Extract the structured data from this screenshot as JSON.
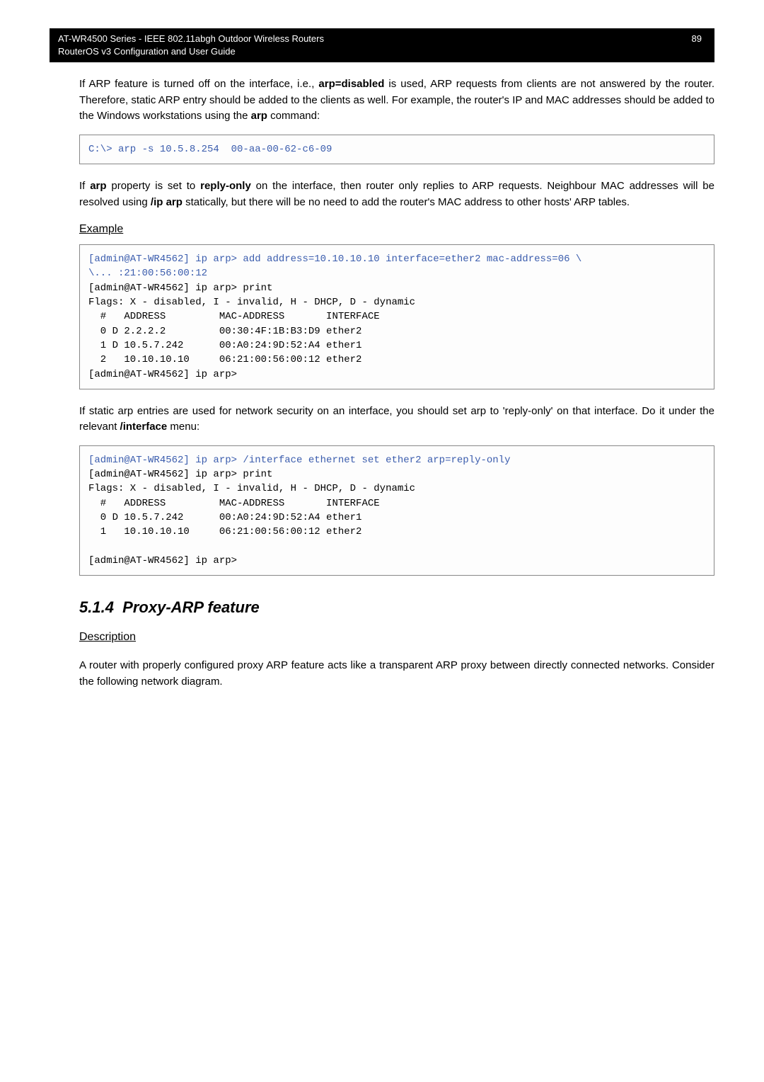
{
  "header": {
    "title_line1": "AT-WR4500 Series - IEEE 802.11abgh Outdoor Wireless Routers",
    "title_line2": "RouterOS v3 Configuration and User Guide",
    "page_number": "89"
  },
  "para1_pre": "If ARP feature is turned off on the interface, i.e., ",
  "para1_bold1": "arp=disabled",
  "para1_mid": " is used, ARP requests from clients are not answered by the router. Therefore, static ARP entry should be added to the clients as well. For example, the router's IP and MAC addresses should be added to the Windows workstations using the ",
  "para1_bold2": "arp",
  "para1_post": " command:",
  "code1": "C:\\> arp -s 10.5.8.254  00-aa-00-62-c6-09",
  "para2_pre": "If ",
  "para2_bold1": "arp",
  "para2_mid1": " property is set to ",
  "para2_bold2": "reply-only",
  "para2_mid2": " on the interface, then router only replies to ARP requests. Neighbour MAC addresses will be resolved using ",
  "para2_bold3": "/ip arp",
  "para2_post": " statically, but there will be no need to add the router's MAC address to other hosts' ARP tables.",
  "example_heading": "Example",
  "code2_blue": "[admin@AT-WR4562] ip arp> add address=10.10.10.10 interface=ether2 mac-address=06 \\\n\\... :21:00:56:00:12",
  "code2_rest": "[admin@AT-WR4562] ip arp> print\nFlags: X - disabled, I - invalid, H - DHCP, D - dynamic\n  #   ADDRESS         MAC-ADDRESS       INTERFACE\n  0 D 2.2.2.2         00:30:4F:1B:B3:D9 ether2\n  1 D 10.5.7.242      00:A0:24:9D:52:A4 ether1\n  2   10.10.10.10     06:21:00:56:00:12 ether2\n[admin@AT-WR4562] ip arp>",
  "para3_pre": "If static arp entries are used for network security on an interface, you should set arp to 'reply-only' on that interface. Do it under the relevant ",
  "para3_bold": "/interface",
  "para3_post": " menu:",
  "code3_blue": "[admin@AT-WR4562] ip arp> /interface ethernet set ether2 arp=reply-only",
  "code3_rest": "[admin@AT-WR4562] ip arp> print\nFlags: X - disabled, I - invalid, H - DHCP, D - dynamic\n  #   ADDRESS         MAC-ADDRESS       INTERFACE\n  0 D 10.5.7.242      00:A0:24:9D:52:A4 ether1\n  1   10.10.10.10     06:21:00:56:00:12 ether2\n\n[admin@AT-WR4562] ip arp>",
  "section_number": "5.1.4",
  "section_title": "Proxy-ARP feature",
  "desc_heading": "Description",
  "para4": "A router with properly configured proxy ARP feature acts like a transparent ARP proxy between directly connected networks. Consider the following network diagram."
}
